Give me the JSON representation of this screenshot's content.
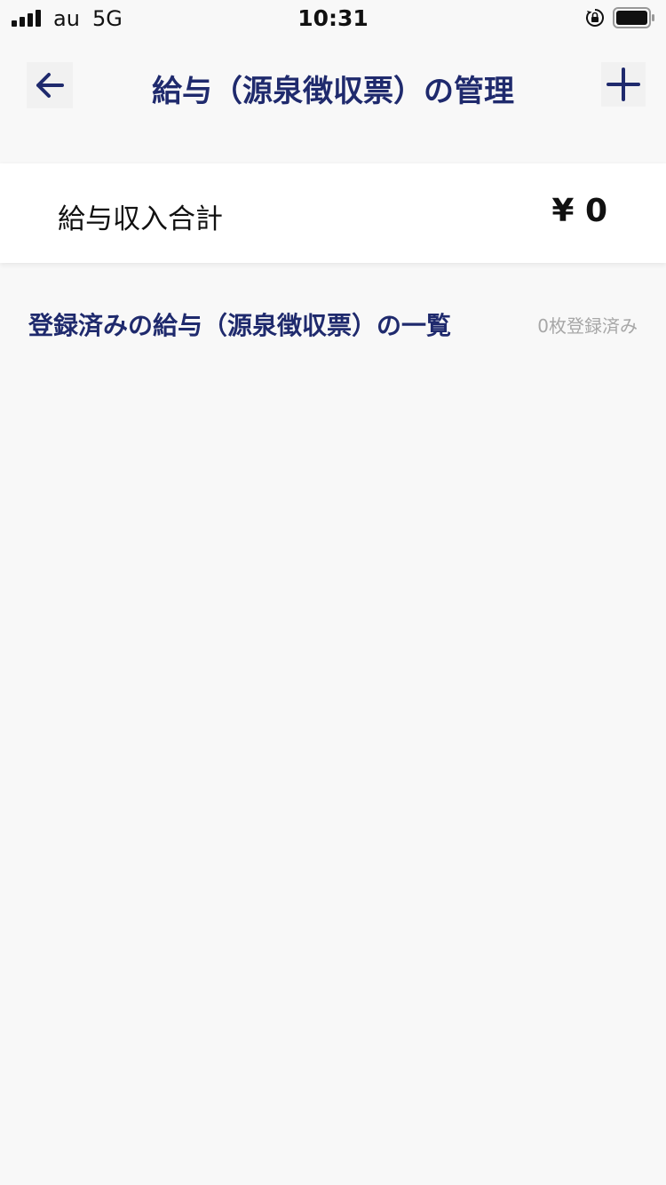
{
  "status_bar": {
    "carrier": "au",
    "network": "5G",
    "time": "10:31",
    "signal_icon": "signal-bars-icon",
    "lock_icon": "orientation-lock-icon",
    "battery_icon": "battery-icon"
  },
  "nav": {
    "back_icon": "arrow-left-icon",
    "title": "給与（源泉徴収票）の管理",
    "add_icon": "plus-icon",
    "accent_color": "#1f2a6d"
  },
  "summary": {
    "label": "給与収入合計",
    "value": "¥ 0"
  },
  "list": {
    "title": "登録済みの給与（源泉徴収票）の一覧",
    "count_text": "0枚登録済み"
  }
}
